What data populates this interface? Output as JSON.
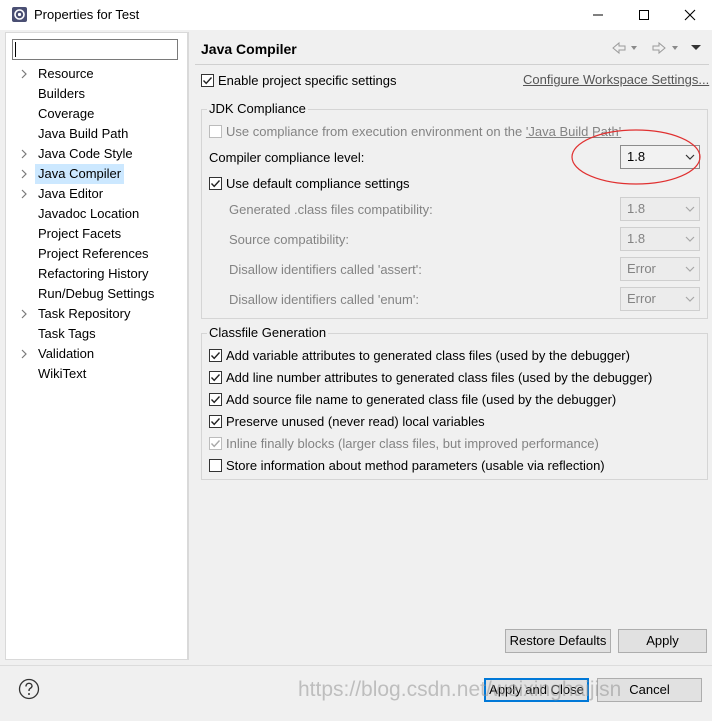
{
  "window": {
    "title": "Properties for Test"
  },
  "filter": {
    "value": ""
  },
  "tree": {
    "items": [
      {
        "label": "Resource",
        "expandable": true
      },
      {
        "label": "Builders",
        "expandable": false
      },
      {
        "label": "Coverage",
        "expandable": false
      },
      {
        "label": "Java Build Path",
        "expandable": false
      },
      {
        "label": "Java Code Style",
        "expandable": true
      },
      {
        "label": "Java Compiler",
        "expandable": true,
        "selected": true
      },
      {
        "label": "Java Editor",
        "expandable": true
      },
      {
        "label": "Javadoc Location",
        "expandable": false
      },
      {
        "label": "Project Facets",
        "expandable": false
      },
      {
        "label": "Project References",
        "expandable": false
      },
      {
        "label": "Refactoring History",
        "expandable": false
      },
      {
        "label": "Run/Debug Settings",
        "expandable": false
      },
      {
        "label": "Task Repository",
        "expandable": true
      },
      {
        "label": "Task Tags",
        "expandable": false
      },
      {
        "label": "Validation",
        "expandable": true
      },
      {
        "label": "WikiText",
        "expandable": false
      }
    ]
  },
  "page": {
    "title": "Java Compiler",
    "enable_specific": {
      "label": "Enable project specific settings",
      "checked": true
    },
    "configure_link": "Configure Workspace Settings..."
  },
  "jdk": {
    "group_label": "JDK Compliance",
    "use_compliance_prefix": "Use compliance from execution environment on the ",
    "use_compliance_link": "'Java Build Path'",
    "use_compliance_checked": false,
    "compliance_label": "Compiler compliance level:",
    "compliance_value": "1.8",
    "use_default": {
      "label": "Use default compliance settings",
      "checked": true
    },
    "generated_label": "Generated .class files compatibility:",
    "generated_value": "1.8",
    "source_label": "Source compatibility:",
    "source_value": "1.8",
    "assert_label": "Disallow identifiers called 'assert':",
    "assert_value": "Error",
    "enum_label": "Disallow identifiers called 'enum':",
    "enum_value": "Error"
  },
  "classfile": {
    "group_label": "Classfile Generation",
    "options": [
      {
        "label": "Add variable attributes to generated class files (used by the debugger)",
        "checked": true,
        "enabled": true
      },
      {
        "label": "Add line number attributes to generated class files (used by the debugger)",
        "checked": true,
        "enabled": true
      },
      {
        "label": "Add source file name to generated class file (used by the debugger)",
        "checked": true,
        "enabled": true
      },
      {
        "label": "Preserve unused (never read) local variables",
        "checked": true,
        "enabled": true
      },
      {
        "label": "Inline finally blocks (larger class files, but improved performance)",
        "checked": true,
        "enabled": false
      },
      {
        "label": "Store information about method parameters (usable via reflection)",
        "checked": false,
        "enabled": true
      }
    ]
  },
  "buttons": {
    "restore_defaults": "Restore Defaults",
    "apply": "Apply",
    "apply_and_close": "Apply and Close",
    "cancel": "Cancel"
  },
  "watermark": "https://blog.csdn.net/weixinghaijisn",
  "colors": {
    "selection": "#cce8ff",
    "annotation_circle": "#e03030",
    "default_button_border": "#0078d7"
  }
}
